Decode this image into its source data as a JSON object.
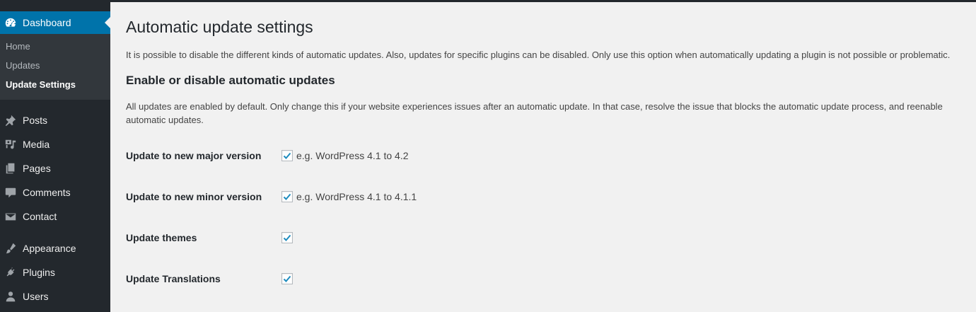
{
  "sidebar": {
    "dashboard": {
      "label": "Dashboard",
      "icon": "dashboard-icon"
    },
    "submenu": [
      {
        "label": "Home"
      },
      {
        "label": "Updates"
      },
      {
        "label": "Update Settings",
        "current": true
      }
    ],
    "items": [
      {
        "label": "Posts",
        "icon": "pushpin-icon"
      },
      {
        "label": "Media",
        "icon": "media-icon"
      },
      {
        "label": "Pages",
        "icon": "pages-icon"
      },
      {
        "label": "Comments",
        "icon": "comment-icon"
      },
      {
        "label": "Contact",
        "icon": "envelope-icon"
      },
      {
        "label": "Appearance",
        "icon": "paintbrush-icon"
      },
      {
        "label": "Plugins",
        "icon": "plug-icon"
      },
      {
        "label": "Users",
        "icon": "user-icon"
      }
    ]
  },
  "main": {
    "title": "Automatic update settings",
    "intro": "It is possible to disable the different kinds of automatic updates. Also, updates for specific plugins can be disabled. Only use this option when automatically updating a plugin is not possible or problematic.",
    "section_title": "Enable or disable automatic updates",
    "section_desc": "All updates are enabled by default. Only change this if your website experiences issues after an automatic update. In that case, resolve the issue that blocks the automatic update process, and reenable automatic updates.",
    "rows": [
      {
        "label": "Update to new major version",
        "checked": true,
        "hint": "e.g. WordPress 4.1 to 4.2"
      },
      {
        "label": "Update to new minor version",
        "checked": true,
        "hint": "e.g. WordPress 4.1 to 4.1.1"
      },
      {
        "label": "Update themes",
        "checked": true,
        "hint": ""
      },
      {
        "label": "Update Translations",
        "checked": true,
        "hint": ""
      }
    ]
  },
  "colors": {
    "sidebar_bg": "#23282d",
    "submenu_bg": "#32373c",
    "accent": "#0073aa",
    "check": "#1e8cbe",
    "page_bg": "#f1f1f1"
  }
}
